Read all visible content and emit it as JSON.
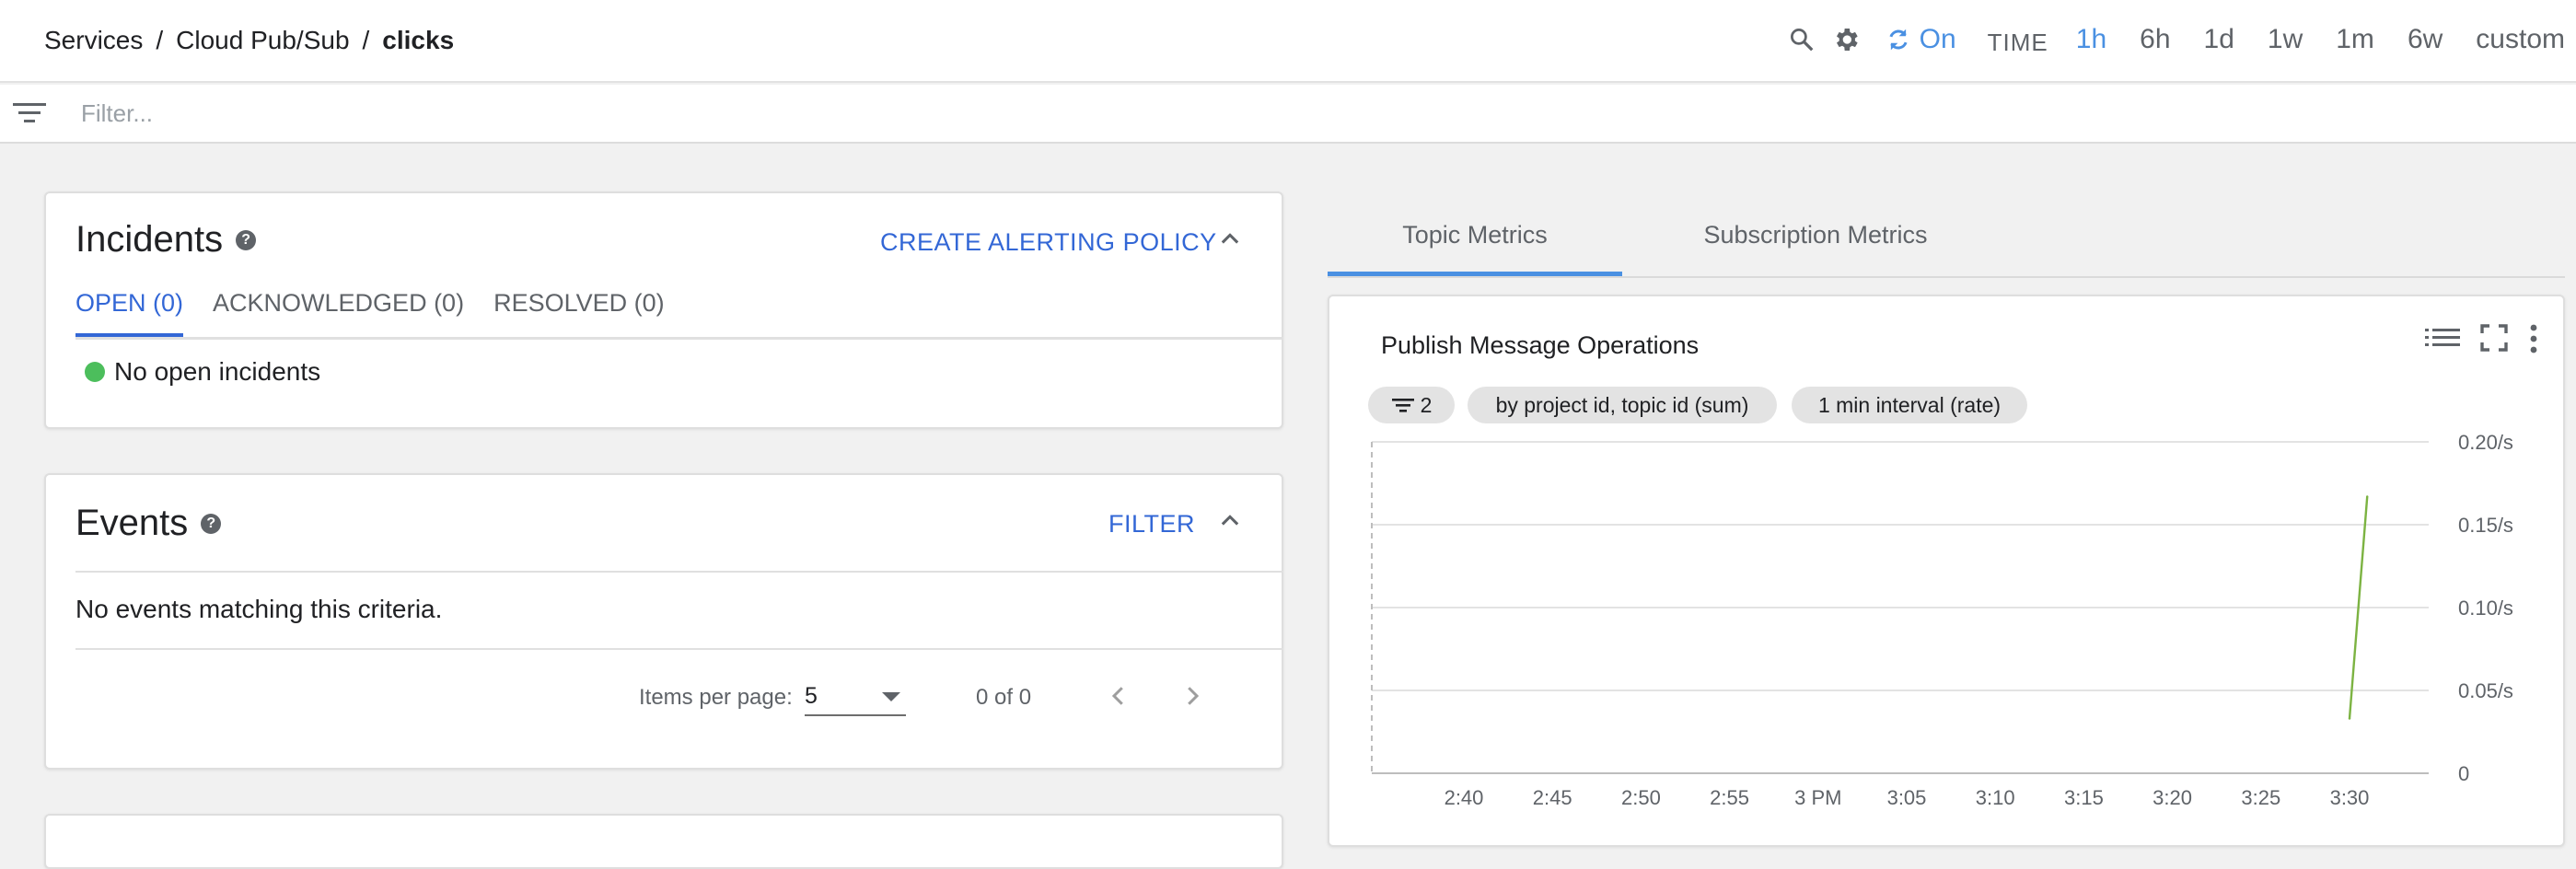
{
  "header": {
    "breadcrumb": [
      "Services",
      "Cloud Pub/Sub",
      "clicks"
    ],
    "separator": "/",
    "auto_refresh": "On",
    "time_label": "TIME",
    "time_options": [
      "1h",
      "6h",
      "1d",
      "1w",
      "1m",
      "6w",
      "custom"
    ],
    "selected_time": "1h"
  },
  "filter": {
    "placeholder": "Filter..."
  },
  "incidents": {
    "title": "Incidents",
    "action": "CREATE ALERTING POLICY",
    "tabs": [
      "OPEN (0)",
      "ACKNOWLEDGED (0)",
      "RESOLVED (0)"
    ],
    "active_tab": "OPEN (0)",
    "status": "No open incidents"
  },
  "events": {
    "title": "Events",
    "action": "FILTER",
    "empty_message": "No events matching this criteria.",
    "items_per_page_label": "Items per page:",
    "items_per_page": "5",
    "range": "0 of 0"
  },
  "metrics": {
    "tabs": [
      "Topic Metrics",
      "Subscription Metrics"
    ],
    "active_tab": "Topic Metrics",
    "chart_title": "Publish Message Operations",
    "chips": [
      "2",
      "by project id, topic id (sum)",
      "1 min interval (rate)"
    ]
  },
  "colors": {
    "accent": "#3367d6",
    "time_active": "#4a90e2",
    "status_ok": "#4cbe5c",
    "series": "#7cb342"
  },
  "chart_data": {
    "type": "line",
    "title": "Publish Message Operations",
    "x_ticks": [
      "2:40",
      "2:45",
      "2:50",
      "2:55",
      "3 PM",
      "3:05",
      "3:10",
      "3:15",
      "3:20",
      "3:25",
      "3:30"
    ],
    "y_ticks": [
      "0",
      "0.05/s",
      "0.10/s",
      "0.15/s",
      "0.20/s"
    ],
    "ylim": [
      0,
      0.2
    ],
    "xlim_minutes": [
      0,
      60
    ],
    "series": [
      {
        "x_minutes": [
          50,
          51
        ],
        "values": [
          0.033,
          0.167
        ]
      }
    ],
    "grid": true
  }
}
